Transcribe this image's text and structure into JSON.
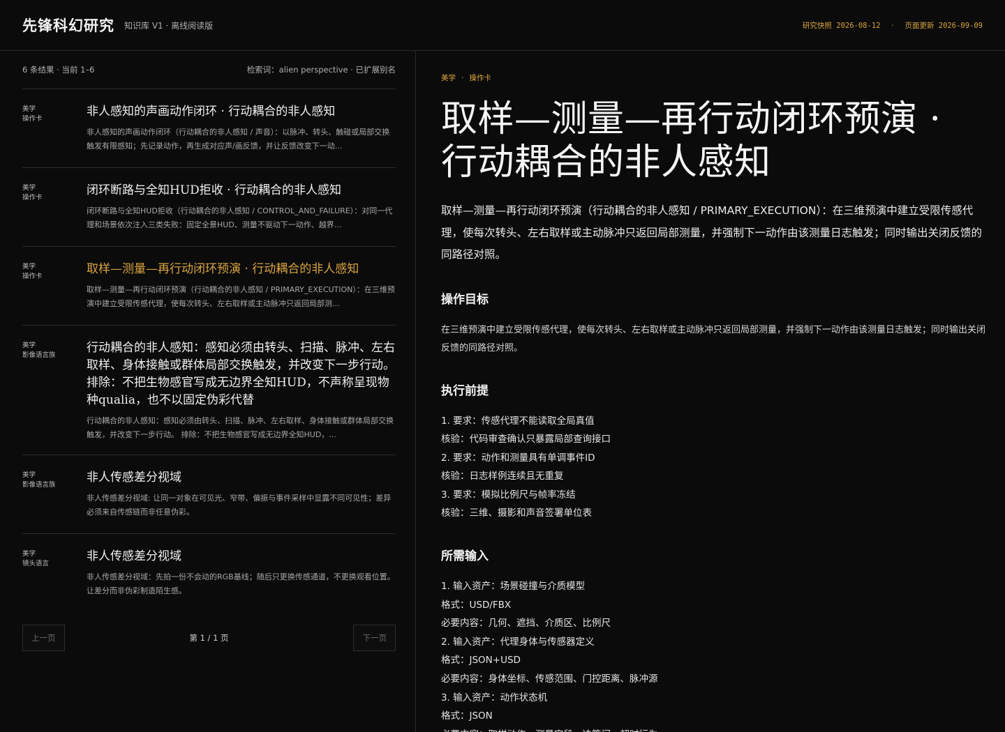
{
  "header": {
    "brand": "先锋科幻研究",
    "subtitle": "知识库 V1 · 离线阅读版",
    "snapshot_label": "研究快照",
    "snapshot_date": "2026-08-12",
    "updated_label": "页面更新",
    "updated_date": "2026-09-09",
    "separator": "·"
  },
  "results": {
    "count_text": "6 条结果 · 当前 1–6",
    "query_text": "检索词：alien perspective · 已扩展别名",
    "items": [
      {
        "tag1": "美学",
        "tag2": "操作卡",
        "title": "非人感知的声画动作闭环 · 行动耦合的非人感知",
        "snippet": "非人感知的声画动作闭环（行动耦合的非人感知 / 声音）：以脉冲、转头、触碰或局部交换触发有限感知；先记录动作，再生成对应声/画反馈，并让反馈改变下一动..."
      },
      {
        "tag1": "美学",
        "tag2": "操作卡",
        "title": "闭环断路与全知HUD拒收 · 行动耦合的非人感知",
        "snippet": "闭环断路与全知HUD拒收（行动耦合的非人感知 / CONTROL_AND_FAILURE）：对同一代理和场景依次注入三类失败：固定全景HUD、测量不驱动下一动作、越界..."
      },
      {
        "tag1": "美学",
        "tag2": "操作卡",
        "title": "取样—测量—再行动闭环预演 · 行动耦合的非人感知",
        "snippet": "取样—测量—再行动闭环预演（行动耦合的非人感知 / PRIMARY_EXECUTION）：在三维预演中建立受限传感代理，使每次转头、左右取样或主动脉冲只返回局部测..."
      },
      {
        "tag1": "美学",
        "tag2": "影像语言族",
        "title": "行动耦合的非人感知：感知必须由转头、扫描、脉冲、左右取样、身体接触或群体局部交换触发，并改变下一步行动。 排除：不把生物感官写成无边界全知HUD，不声称呈现物种qualia，也不以固定伪彩代替",
        "snippet": "行动耦合的非人感知：感知必须由转头、扫描、脉冲、左右取样、身体接触或群体局部交换触发，并改变下一步行动。 排除：不把生物感官写成无边界全知HUD，..."
      },
      {
        "tag1": "美学",
        "tag2": "影像语言族",
        "title": "非人传感差分视域",
        "snippet": "非人传感差分视域: 让同一对象在可见光、窄带、偏振与事件采样中显露不同可见性；差异必须来自传感链而非任意伪彩。"
      },
      {
        "tag1": "美学",
        "tag2": "镜头语言",
        "title": "非人传感差分视域",
        "snippet": "非人传感差分视域：先拍一份不会动的RGB基线；随后只更换传感通道，不更换观看位置。让差分而非伪彩制造陌生感。"
      }
    ]
  },
  "pager": {
    "prev": "上一页",
    "info": "第 1 / 1 页",
    "next": "下一页"
  },
  "detail": {
    "crumb1": "美学",
    "crumb_sep": "·",
    "crumb2": "操作卡",
    "title": "取样—测量—再行动闭环预演 · 行动耦合的非人感知",
    "lead": "取样—测量—再行动闭环预演（行动耦合的非人感知 / PRIMARY_EXECUTION）：在三维预演中建立受限传感代理，使每次转头、左右取样或主动脉冲只返回局部测量，并强制下一动作由该测量日志触发；同时输出关闭反馈的同路径对照。",
    "goal_heading": "操作目标",
    "goal_text": "在三维预演中建立受限传感代理，使每次转头、左右取样或主动脉冲只返回局部测量，并强制下一动作由该测量日志触发；同时输出关闭反馈的同路径对照。",
    "prereq_heading": "执行前提",
    "prereq_lines": [
      "1. 要求：传感代理不能读取全局真值",
      "核验：代码审查确认只暴露局部查询接口",
      "2. 要求：动作和测量具有单调事件ID",
      "核验：日志样例连续且无重复",
      "3. 要求：模拟比例尺与帧率冻结",
      "核验：三维、摄影和声音签署单位表"
    ],
    "inputs_heading": "所需输入",
    "inputs_lines": [
      "1. 输入资产：场景碰撞与介质模型",
      "格式：USD/FBX",
      "必要内容：几何、遮挡、介质区、比例尺",
      "2. 输入资产：代理身体与传感器定义",
      "格式：JSON+USD",
      "必要内容：身体坐标、传感范围、门控距离、脉冲源",
      "3. 输入资产：动作状态机",
      "格式：JSON",
      "必要内容：取样动作、测量字段、决策门、超时行为"
    ]
  }
}
